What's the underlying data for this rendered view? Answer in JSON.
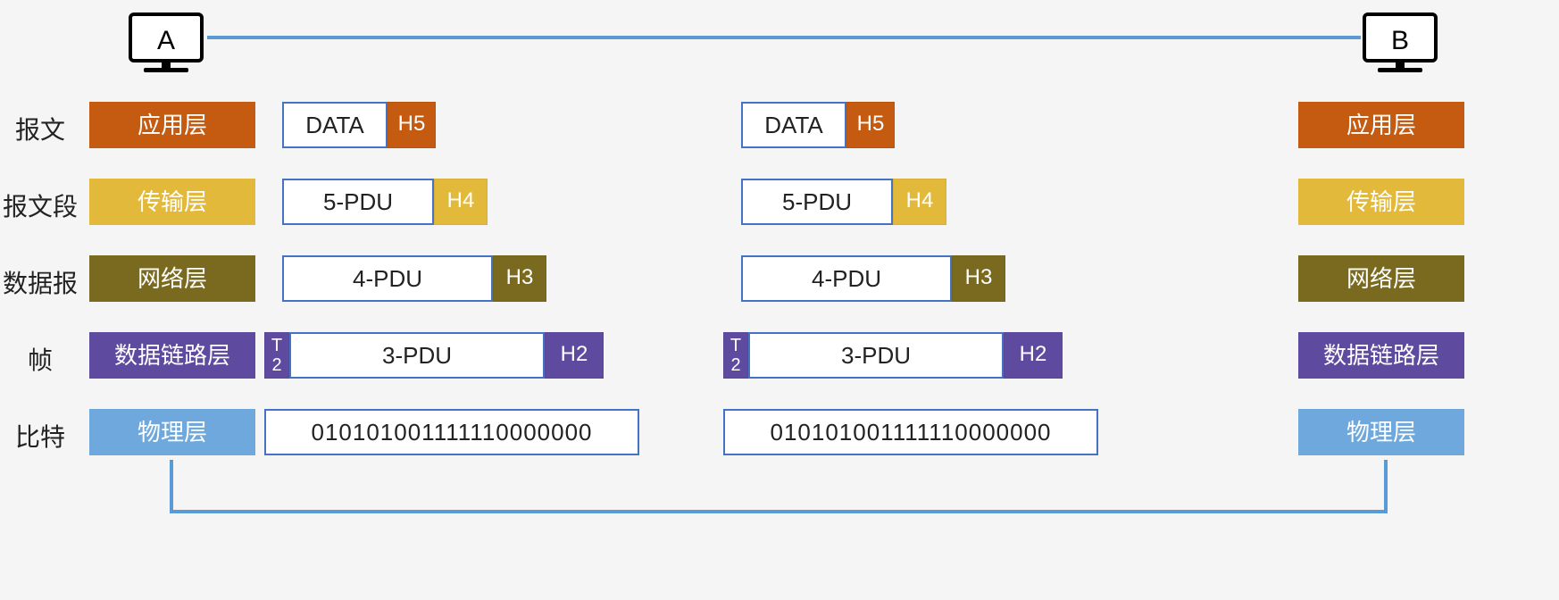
{
  "hosts": {
    "a": "A",
    "b": "B"
  },
  "row_labels": {
    "msg": "报文",
    "seg": "报文段",
    "pkt": "数据报",
    "frm": "帧",
    "bit": "比特"
  },
  "layers": {
    "app": "应用层",
    "tran": "传输层",
    "net": "网络层",
    "link": "数据链路层",
    "phy": "物理层"
  },
  "pdu": {
    "data": "DATA",
    "h5": "H5",
    "p5": "5-PDU",
    "h4": "H4",
    "p4": "4-PDU",
    "h3": "H3",
    "t2": "T\n2",
    "p3": "3-PDU",
    "h2": "H2",
    "bits": "010101001111110000000"
  },
  "colors": {
    "app": "#C55A11",
    "tran": "#E2B93B",
    "net": "#7A6A1F",
    "link": "#5E4A9E",
    "phy": "#6FA8DC",
    "line": "#5B9BD5"
  }
}
